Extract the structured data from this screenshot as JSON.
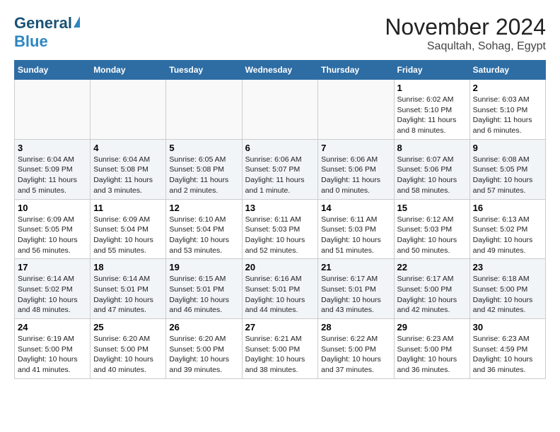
{
  "header": {
    "logo_general": "General",
    "logo_blue": "Blue",
    "month_title": "November 2024",
    "location": "Saqultah, Sohag, Egypt"
  },
  "weekdays": [
    "Sunday",
    "Monday",
    "Tuesday",
    "Wednesday",
    "Thursday",
    "Friday",
    "Saturday"
  ],
  "weeks": [
    [
      {
        "day": "",
        "info": ""
      },
      {
        "day": "",
        "info": ""
      },
      {
        "day": "",
        "info": ""
      },
      {
        "day": "",
        "info": ""
      },
      {
        "day": "",
        "info": ""
      },
      {
        "day": "1",
        "info": "Sunrise: 6:02 AM\nSunset: 5:10 PM\nDaylight: 11 hours and 8 minutes."
      },
      {
        "day": "2",
        "info": "Sunrise: 6:03 AM\nSunset: 5:10 PM\nDaylight: 11 hours and 6 minutes."
      }
    ],
    [
      {
        "day": "3",
        "info": "Sunrise: 6:04 AM\nSunset: 5:09 PM\nDaylight: 11 hours and 5 minutes."
      },
      {
        "day": "4",
        "info": "Sunrise: 6:04 AM\nSunset: 5:08 PM\nDaylight: 11 hours and 3 minutes."
      },
      {
        "day": "5",
        "info": "Sunrise: 6:05 AM\nSunset: 5:08 PM\nDaylight: 11 hours and 2 minutes."
      },
      {
        "day": "6",
        "info": "Sunrise: 6:06 AM\nSunset: 5:07 PM\nDaylight: 11 hours and 1 minute."
      },
      {
        "day": "7",
        "info": "Sunrise: 6:06 AM\nSunset: 5:06 PM\nDaylight: 11 hours and 0 minutes."
      },
      {
        "day": "8",
        "info": "Sunrise: 6:07 AM\nSunset: 5:06 PM\nDaylight: 10 hours and 58 minutes."
      },
      {
        "day": "9",
        "info": "Sunrise: 6:08 AM\nSunset: 5:05 PM\nDaylight: 10 hours and 57 minutes."
      }
    ],
    [
      {
        "day": "10",
        "info": "Sunrise: 6:09 AM\nSunset: 5:05 PM\nDaylight: 10 hours and 56 minutes."
      },
      {
        "day": "11",
        "info": "Sunrise: 6:09 AM\nSunset: 5:04 PM\nDaylight: 10 hours and 55 minutes."
      },
      {
        "day": "12",
        "info": "Sunrise: 6:10 AM\nSunset: 5:04 PM\nDaylight: 10 hours and 53 minutes."
      },
      {
        "day": "13",
        "info": "Sunrise: 6:11 AM\nSunset: 5:03 PM\nDaylight: 10 hours and 52 minutes."
      },
      {
        "day": "14",
        "info": "Sunrise: 6:11 AM\nSunset: 5:03 PM\nDaylight: 10 hours and 51 minutes."
      },
      {
        "day": "15",
        "info": "Sunrise: 6:12 AM\nSunset: 5:03 PM\nDaylight: 10 hours and 50 minutes."
      },
      {
        "day": "16",
        "info": "Sunrise: 6:13 AM\nSunset: 5:02 PM\nDaylight: 10 hours and 49 minutes."
      }
    ],
    [
      {
        "day": "17",
        "info": "Sunrise: 6:14 AM\nSunset: 5:02 PM\nDaylight: 10 hours and 48 minutes."
      },
      {
        "day": "18",
        "info": "Sunrise: 6:14 AM\nSunset: 5:01 PM\nDaylight: 10 hours and 47 minutes."
      },
      {
        "day": "19",
        "info": "Sunrise: 6:15 AM\nSunset: 5:01 PM\nDaylight: 10 hours and 46 minutes."
      },
      {
        "day": "20",
        "info": "Sunrise: 6:16 AM\nSunset: 5:01 PM\nDaylight: 10 hours and 44 minutes."
      },
      {
        "day": "21",
        "info": "Sunrise: 6:17 AM\nSunset: 5:01 PM\nDaylight: 10 hours and 43 minutes."
      },
      {
        "day": "22",
        "info": "Sunrise: 6:17 AM\nSunset: 5:00 PM\nDaylight: 10 hours and 42 minutes."
      },
      {
        "day": "23",
        "info": "Sunrise: 6:18 AM\nSunset: 5:00 PM\nDaylight: 10 hours and 42 minutes."
      }
    ],
    [
      {
        "day": "24",
        "info": "Sunrise: 6:19 AM\nSunset: 5:00 PM\nDaylight: 10 hours and 41 minutes."
      },
      {
        "day": "25",
        "info": "Sunrise: 6:20 AM\nSunset: 5:00 PM\nDaylight: 10 hours and 40 minutes."
      },
      {
        "day": "26",
        "info": "Sunrise: 6:20 AM\nSunset: 5:00 PM\nDaylight: 10 hours and 39 minutes."
      },
      {
        "day": "27",
        "info": "Sunrise: 6:21 AM\nSunset: 5:00 PM\nDaylight: 10 hours and 38 minutes."
      },
      {
        "day": "28",
        "info": "Sunrise: 6:22 AM\nSunset: 5:00 PM\nDaylight: 10 hours and 37 minutes."
      },
      {
        "day": "29",
        "info": "Sunrise: 6:23 AM\nSunset: 5:00 PM\nDaylight: 10 hours and 36 minutes."
      },
      {
        "day": "30",
        "info": "Sunrise: 6:23 AM\nSunset: 4:59 PM\nDaylight: 10 hours and 36 minutes."
      }
    ]
  ]
}
